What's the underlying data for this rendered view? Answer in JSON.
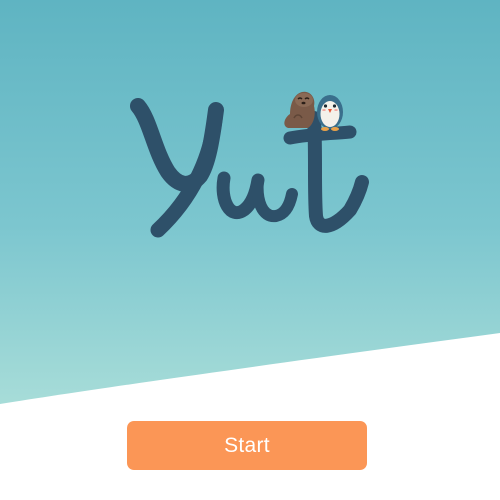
{
  "app": {
    "logo_text": "Yut",
    "mascots": [
      "seal-icon",
      "penguin-icon"
    ]
  },
  "start": {
    "label": "Start"
  },
  "colors": {
    "sky_top": "#5fb4c2",
    "sky_bottom": "#b6e4de",
    "logo": "#2e5069",
    "button": "#fb9656",
    "button_text": "#ffffff",
    "ground": "#ffffff"
  }
}
